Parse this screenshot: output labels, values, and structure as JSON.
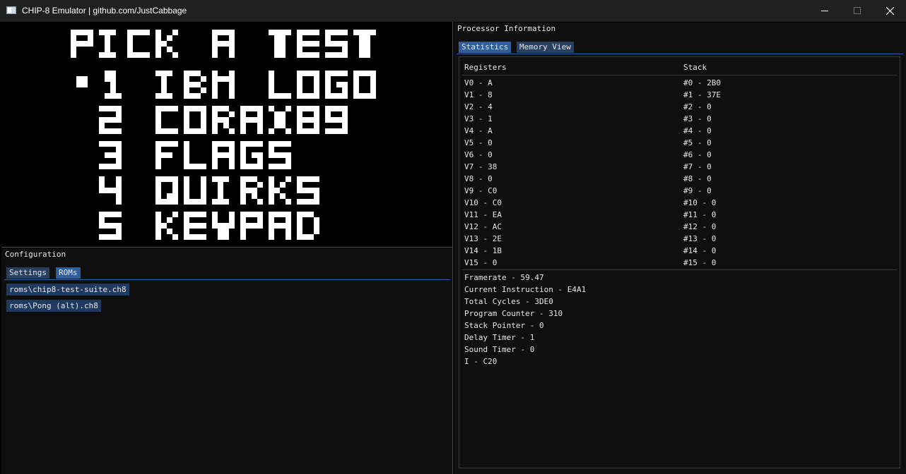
{
  "window": {
    "title": "CHIP-8 Emulator | github.com/JustCabbage",
    "controls": {
      "minimize": "minimize-icon",
      "maximize": "maximize-icon",
      "close": "close-icon"
    }
  },
  "display": {
    "lines": [
      "PICK A TEST",
      "•1 IBM LOGO",
      " 2 CORAX89",
      " 3 FLAGS",
      " 4 QUIRKS",
      " 5 KEYPAD"
    ],
    "colors": {
      "on": "#ffffff",
      "off": "#000000"
    }
  },
  "configuration": {
    "title": "Configuration",
    "tabs": [
      "Settings",
      "ROMs"
    ],
    "active_tab": "ROMs",
    "roms": [
      "roms\\chip8-test-suite.ch8",
      "roms\\Pong (alt).ch8"
    ]
  },
  "processor": {
    "title": "Processor Information",
    "tabs": [
      "Statistics",
      "Memory View"
    ],
    "active_tab": "Statistics",
    "headers": {
      "registers": "Registers",
      "stack": "Stack"
    },
    "registers": [
      "V0 - A",
      "V1 - 8",
      "V2 - 4",
      "V3 - 1",
      "V4 - A",
      "V5 - 0",
      "V6 - 0",
      "V7 - 38",
      "V8 - 0",
      "V9 - C0",
      "V10 - C0",
      "V11 - EA",
      "V12 - AC",
      "V13 - 2E",
      "V14 - 1B",
      "V15 - 0"
    ],
    "stack": [
      "#0 - 2B0",
      "#1 - 37E",
      "#2 - 0",
      "#3 - 0",
      "#4 - 0",
      "#5 - 0",
      "#6 - 0",
      "#7 - 0",
      "#8 - 0",
      "#9 - 0",
      "#10 - 0",
      "#11 - 0",
      "#12 - 0",
      "#13 - 0",
      "#14 - 0",
      "#15 - 0"
    ],
    "stats": [
      "Framerate - 59.47",
      "Current Instruction - E4A1",
      "Total Cycles - 3DE0",
      "Program Counter - 310",
      "Stack Pointer - 0",
      "Delay Timer - 1",
      "Sound Timer - 0",
      "I - C20"
    ]
  },
  "colors": {
    "titlebar": "#202020",
    "panel": "#0f0f0f",
    "tab_active": "#2e5f9b",
    "tab_inactive": "#2a3f5f",
    "rom_button": "#203a5f"
  }
}
